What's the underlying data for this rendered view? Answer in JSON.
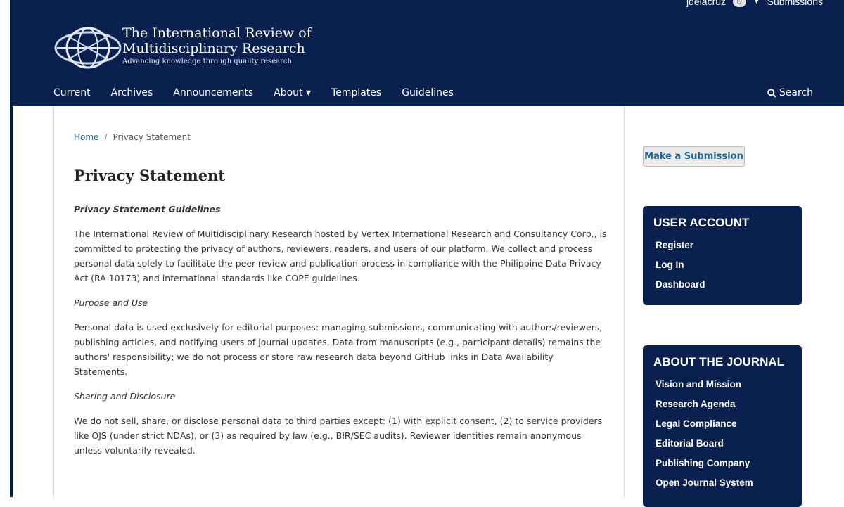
{
  "user_nav": {
    "username": "jdelacruz",
    "count": "0",
    "submissions": "Submissions"
  },
  "logo": {
    "title_line1": "The International Review of",
    "title_line2": "Multidisciplinary Research",
    "tagline": "Advancing knowledge through quality research"
  },
  "nav": {
    "items": [
      {
        "label": "Current"
      },
      {
        "label": "Archives"
      },
      {
        "label": "Announcements"
      },
      {
        "label": "About ▾"
      },
      {
        "label": "Templates"
      },
      {
        "label": "Guidelines"
      }
    ],
    "search_label": "Search"
  },
  "breadcrumb": {
    "home": "Home",
    "separator": "/",
    "current": "Privacy Statement"
  },
  "page_title": "Privacy Statement",
  "body": {
    "guidelines_heading": "Privacy Statement Guidelines",
    "intro": "The International Review of Multidisciplinary Research hosted by Vertex International Research and Consultancy Corp., is committed to protecting the privacy of authors, reviewers, readers, and users of our platform. We collect and process personal data solely to facilitate the peer-review and publication process in compliance with the Philippine Data Privacy Act (RA 10173) and international standards like COPE guidelines.",
    "purpose_heading": "Purpose and Use",
    "purpose_text": "Personal data is used exclusively for editorial purposes: managing submissions, communicating with authors/reviewers, publishing articles, and notifying users of journal updates. Data from manuscripts (e.g., participant details) remains the authors' responsibility; we do not process or store raw research data beyond GitHub links in Data Availability Statements.",
    "sharing_heading": "Sharing and Disclosure",
    "sharing_text": "We do not sell, share, or disclose personal data to third parties except: (1) with explicit consent, (2) to service providers like OJS (under strict NDAs), or (3) as required by law (e.g., BIR/SEC audits). Reviewer identities remain anonymous unless voluntarily revealed."
  },
  "sidebar": {
    "submit_label": "Make a Submission",
    "user_account": {
      "title": "USER ACCOUNT",
      "items": [
        "Register",
        "Log In",
        "Dashboard"
      ]
    },
    "about_journal": {
      "title": "ABOUT THE JOURNAL",
      "items": [
        "Vision and Mission",
        "Research Agenda",
        "Legal Compliance",
        "Editorial Board",
        "Publishing Company",
        "Open Journal System"
      ]
    }
  },
  "colors": {
    "header_bg": "#0a2150",
    "link": "#1e6292"
  }
}
